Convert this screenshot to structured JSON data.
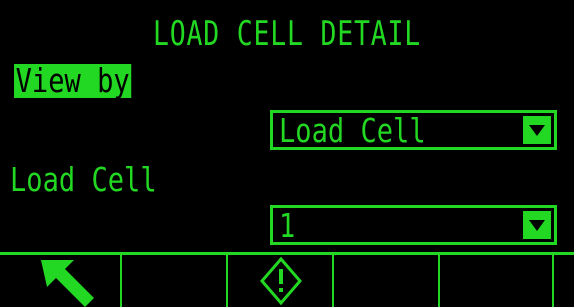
{
  "screen": {
    "title": "LOAD CELL DETAIL",
    "colors": {
      "foreground": "#22d822",
      "background": "#000000"
    }
  },
  "fields": {
    "view_by": {
      "label": "View by",
      "selected": "Load Cell"
    },
    "load_cell": {
      "label": "Load Cell",
      "selected": "1"
    }
  },
  "softkeys": [
    {
      "icon": "exit-arrow-icon"
    },
    {
      "icon": ""
    },
    {
      "icon": "start-diamond-icon"
    },
    {
      "icon": ""
    },
    {
      "icon": ""
    }
  ]
}
